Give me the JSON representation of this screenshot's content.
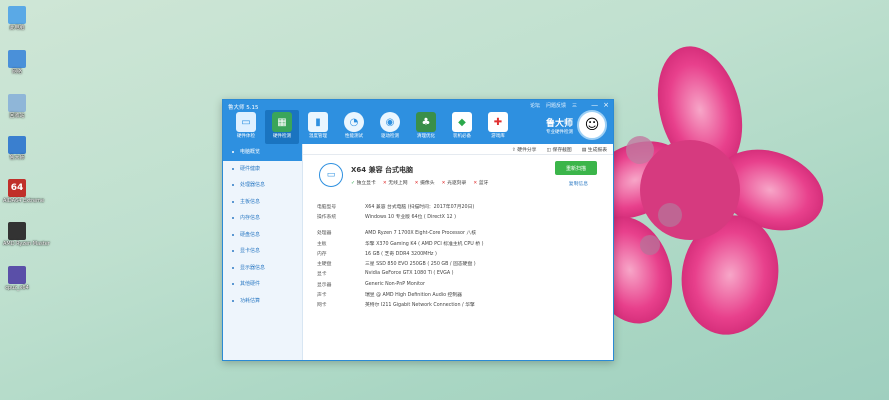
{
  "desktop": {
    "icons": [
      {
        "label": "此电脑",
        "icon": "computer-icon",
        "color": "#5aa9e6"
      },
      {
        "label": "网络",
        "icon": "network-icon",
        "color": "#4a90d9"
      },
      {
        "label": "回收站",
        "icon": "recycle-bin-icon",
        "color": "#8fb6d8"
      },
      {
        "label": "鲁大师",
        "icon": "ludashi-icon",
        "color": "#3a7fcf"
      },
      {
        "label": "AIDA64 Extreme",
        "icon": "aida64-icon",
        "color": "#c0302a"
      },
      {
        "label": "AMD Ryzen Master",
        "icon": "ryzen-master-icon",
        "color": "#333333"
      },
      {
        "label": "cpuz_x64",
        "icon": "cpuz-icon",
        "color": "#5a4fa8"
      }
    ]
  },
  "window": {
    "title": "鲁大师 5.15",
    "title_links": [
      "论坛",
      "问题反馈",
      "三"
    ],
    "controls": [
      "—",
      "×"
    ],
    "toolbar": [
      {
        "label": "硬件体检",
        "icon": "monitor-check-icon"
      },
      {
        "label": "硬件检测",
        "icon": "motherboard-icon"
      },
      {
        "label": "温度管理",
        "icon": "thermometer-icon"
      },
      {
        "label": "性能测试",
        "icon": "speedometer-icon"
      },
      {
        "label": "驱动检测",
        "icon": "driver-disc-icon"
      },
      {
        "label": "清理优化",
        "icon": "broom-icon"
      },
      {
        "label": "装机必备",
        "icon": "cube-icon"
      },
      {
        "label": "游戏库",
        "icon": "gamepad-icon"
      }
    ],
    "brand": {
      "name": "鲁大师",
      "slogan": "专业硬件检测"
    }
  },
  "sidebar": {
    "items": [
      {
        "label": "电脑概览"
      },
      {
        "label": "硬件健康"
      },
      {
        "label": "处理器信息"
      },
      {
        "label": "主板信息"
      },
      {
        "label": "内存信息"
      },
      {
        "label": "硬盘信息"
      },
      {
        "label": "显卡信息"
      },
      {
        "label": "显示器信息"
      },
      {
        "label": "其他硬件"
      },
      {
        "label": "功耗估算"
      }
    ]
  },
  "subbar": {
    "share": "硬件分享",
    "screenshot": "保存截图",
    "report": "生成报表"
  },
  "summary": {
    "title": "X64 兼容 台式电脑",
    "checks": [
      {
        "mark": "✓",
        "label": "独立显卡",
        "ok": true
      },
      {
        "mark": "✕",
        "label": "无线上网",
        "ok": false
      },
      {
        "mark": "✕",
        "label": "摄像头",
        "ok": false
      },
      {
        "mark": "✕",
        "label": "光驱刻录",
        "ok": false
      },
      {
        "mark": "✕",
        "label": "蓝牙",
        "ok": false
      }
    ],
    "rescan_label": "重新扫描",
    "copy_label": "复制信息"
  },
  "info": {
    "group1": [
      {
        "k": "电脑型号",
        "v": "X64 兼容 台式电脑 (扫描时间：2017年07月20日)"
      },
      {
        "k": "操作系统",
        "v": "Windows 10 专业版 64位 ( DirectX 12 )"
      }
    ],
    "group2": [
      {
        "k": "处理器",
        "v": "AMD Ryzen 7 1700X Eight-Core Processor 八核"
      },
      {
        "k": "主板",
        "v": "华擎 X370 Gaming K4 ( AMD PCI 标准主机 CPU 桥 )"
      },
      {
        "k": "内存",
        "v": "16 GB ( 芝奇 DDR4 3200MHz )"
      },
      {
        "k": "主硬盘",
        "v": "三星 SSD 850 EVO 250GB ( 250 GB / 固态硬盘 )"
      },
      {
        "k": "显卡",
        "v": "Nvidia GeForce GTX 1080 Ti ( EVGA )"
      },
      {
        "k": "显示器",
        "v": "Generic Non-PnP Monitor"
      },
      {
        "k": "声卡",
        "v": "瑞昱 @ AMD High Definition Audio 控制器"
      },
      {
        "k": "网卡",
        "v": "英特尔 I211 Gigabit Network Connection / 华擎"
      }
    ]
  }
}
